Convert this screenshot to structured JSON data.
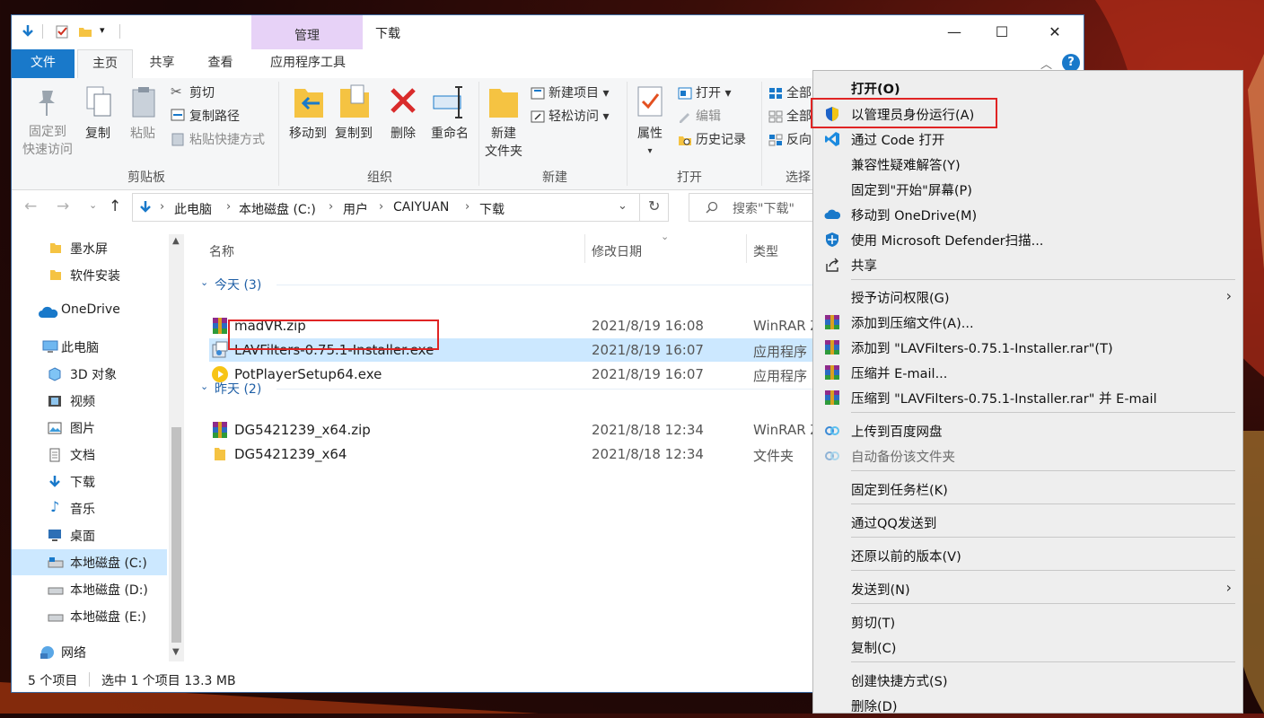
{
  "window": {
    "title": "下载",
    "context_tab": "管理",
    "controls": [
      "—",
      "☐",
      "✕"
    ]
  },
  "tabs": {
    "file": "文件",
    "home": "主页",
    "share": "共享",
    "view": "查看",
    "app_tools": "应用程序工具"
  },
  "ribbon": {
    "pin_label1": "固定到",
    "pin_label2": "快速访问",
    "copy": "复制",
    "paste": "粘贴",
    "cut": "剪切",
    "copy_path": "复制路径",
    "paste_shortcut": "粘贴快捷方式",
    "move_to": "移动到",
    "copy_to": "复制到",
    "delete": "删除",
    "rename": "重命名",
    "new_folder1": "新建",
    "new_folder2": "文件夹",
    "new_item": "新建项目",
    "easy_access": "轻松访问",
    "properties": "属性",
    "open": "打开",
    "edit": "编辑",
    "history": "历史记录",
    "select_all": "全部",
    "select_none": "全部",
    "invert": "反向",
    "groups": {
      "clipboard": "剪贴板",
      "organize": "组织",
      "new": "新建",
      "open": "打开",
      "select": "选择"
    }
  },
  "address": {
    "crumbs": [
      "此电脑",
      "本地磁盘 (C:)",
      "用户",
      "CAIYUAN",
      "下载"
    ],
    "search_placeholder": "搜索\"下载\""
  },
  "nav": {
    "items": [
      "墨水屏",
      "软件安装",
      "OneDrive",
      "此电脑",
      "3D 对象",
      "视频",
      "图片",
      "文档",
      "下载",
      "音乐",
      "桌面",
      "本地磁盘 (C:)",
      "本地磁盘 (D:)",
      "本地磁盘 (E:)",
      "网络"
    ]
  },
  "columns": {
    "name": "名称",
    "modified": "修改日期",
    "type": "类型"
  },
  "groups": {
    "today": "今天 (3)",
    "yesterday": "昨天 (2)"
  },
  "files": [
    {
      "name": "madVR.zip",
      "date": "2021/8/19 16:08",
      "type": "WinRAR Z"
    },
    {
      "name": "LAVFilters-0.75.1-Installer.exe",
      "date": "2021/8/19 16:07",
      "type": "应用程序"
    },
    {
      "name": "PotPlayerSetup64.exe",
      "date": "2021/8/19 16:07",
      "type": "应用程序"
    },
    {
      "name": "DG5421239_x64.zip",
      "date": "2021/8/18 12:34",
      "type": "WinRAR Z"
    },
    {
      "name": "DG5421239_x64",
      "date": "2021/8/18 12:34",
      "type": "文件夹"
    }
  ],
  "status": {
    "count": "5 个项目",
    "selection": "选中 1 个项目  13.3 MB"
  },
  "context_menu": {
    "open": "打开(O)",
    "run_as_admin": "以管理员身份运行(A)",
    "open_code": "通过 Code 打开",
    "compat": "兼容性疑难解答(Y)",
    "pin_start": "固定到\"开始\"屏幕(P)",
    "onedrive": "移动到 OneDrive(M)",
    "defender": "使用 Microsoft Defender扫描...",
    "share": "共享",
    "grant": "授予访问权限(G)",
    "add_archive": "添加到压缩文件(A)...",
    "add_rar": "添加到 \"LAVFilters-0.75.1-Installer.rar\"(T)",
    "compress_email": "压缩并 E-mail...",
    "compress_rar_email": "压缩到 \"LAVFilters-0.75.1-Installer.rar\" 并 E-mail",
    "baidu_upload": "上传到百度网盘",
    "baidu_backup": "自动备份该文件夹",
    "pin_taskbar": "固定到任务栏(K)",
    "qq_send": "通过QQ发送到",
    "restore": "还原以前的版本(V)",
    "send_to": "发送到(N)",
    "cut": "剪切(T)",
    "copy": "复制(C)",
    "create_shortcut": "创建快捷方式(S)",
    "delete": "删除(D)"
  }
}
